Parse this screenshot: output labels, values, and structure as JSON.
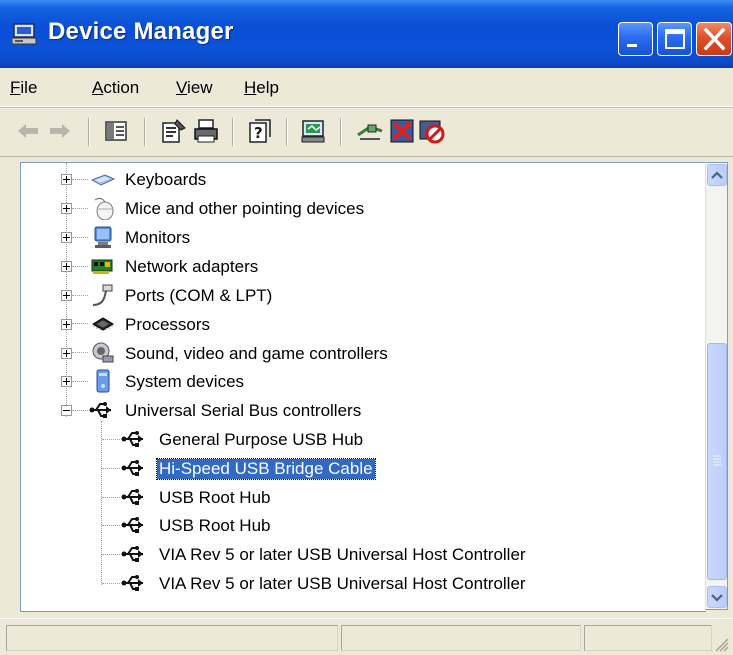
{
  "window": {
    "title": "Device Manager"
  },
  "menu": [
    {
      "key": "F",
      "rest": "ile"
    },
    {
      "key": "A",
      "rest": "ction"
    },
    {
      "key": "V",
      "rest": "iew"
    },
    {
      "key": "H",
      "rest": "elp"
    }
  ],
  "toolbar": {
    "icons": [
      "back-arrow-icon",
      "forward-arrow-icon",
      "show-hide-console-tree-icon",
      "properties-icon",
      "print-icon",
      "help-icon",
      "scan-hardware-icon",
      "update-driver-icon",
      "uninstall-icon",
      "disable-icon"
    ]
  },
  "tree": {
    "categories": [
      {
        "label": "Keyboards",
        "icon": "keyboard-icon",
        "expanded": false
      },
      {
        "label": "Mice and other pointing devices",
        "icon": "mouse-icon",
        "expanded": false
      },
      {
        "label": "Monitors",
        "icon": "monitor-icon",
        "expanded": false
      },
      {
        "label": "Network adapters",
        "icon": "network-adapter-icon",
        "expanded": false
      },
      {
        "label": "Ports (COM & LPT)",
        "icon": "port-icon",
        "expanded": false
      },
      {
        "label": "Processors",
        "icon": "processor-icon",
        "expanded": false
      },
      {
        "label": "Sound, video and game controllers",
        "icon": "sound-icon",
        "expanded": false
      },
      {
        "label": "System devices",
        "icon": "system-device-icon",
        "expanded": false
      },
      {
        "label": "Universal Serial Bus controllers",
        "icon": "usb-icon",
        "expanded": true
      }
    ],
    "usb_children": [
      {
        "label": "General Purpose USB Hub",
        "selected": false
      },
      {
        "label": "Hi-Speed USB Bridge Cable",
        "selected": true
      },
      {
        "label": "USB Root Hub",
        "selected": false
      },
      {
        "label": "USB Root Hub",
        "selected": false
      },
      {
        "label": "VIA Rev 5 or later USB Universal Host Controller",
        "selected": false
      },
      {
        "label": "VIA Rev 5 or later USB Universal Host Controller",
        "selected": false
      }
    ]
  },
  "colors": {
    "titlebar": "#0a4fd6",
    "selection": "#316ac5",
    "close_button": "#e0502c"
  }
}
